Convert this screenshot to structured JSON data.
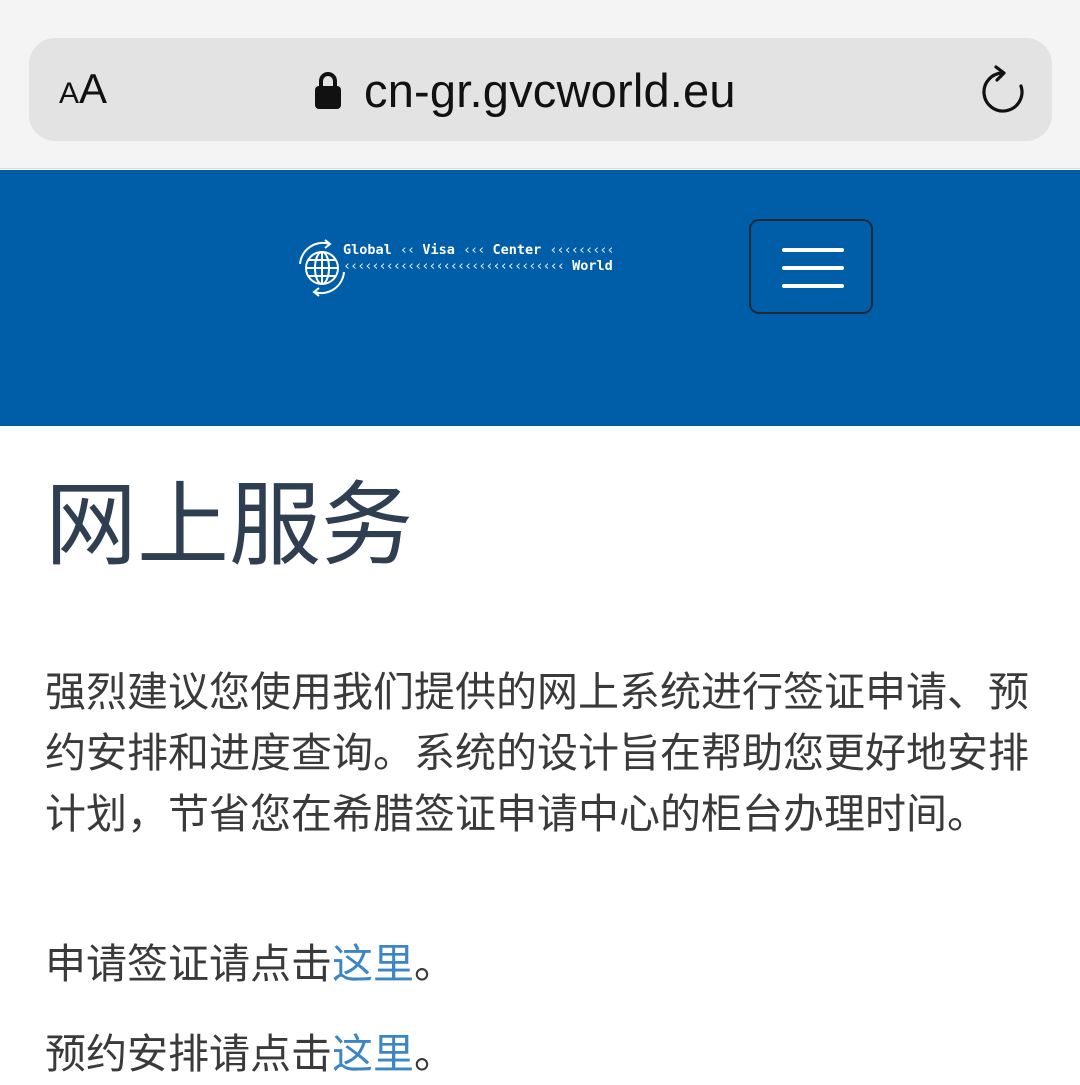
{
  "browser": {
    "text_size_small": "A",
    "text_size_big": "A",
    "url": "cn-gr.gvcworld.eu"
  },
  "logo": {
    "word_global": "Global",
    "word_visa": "Visa",
    "word_center": "Center",
    "word_world": "World"
  },
  "main": {
    "title": "网上服务",
    "intro": "强烈建议您使用我们提供的网上系统进行签证申请、预约安排和进度查询。系统的设计旨在帮助您更好地安排计划，节省您在希腊签证申请中心的柜台办理时间。",
    "apply_prefix": "申请签证请点击",
    "apply_link": "这里",
    "apply_suffix": "。",
    "appointment_prefix": "预约安排请点击",
    "appointment_link": "这里",
    "appointment_suffix": "。"
  },
  "colors": {
    "header_bg": "#005ea8",
    "title_text": "#2f3e51",
    "body_text": "#3a3a3a",
    "link": "#3d86c6"
  },
  "icons": [
    "lock-icon",
    "reload-icon",
    "menu-icon",
    "globe-icon"
  ]
}
